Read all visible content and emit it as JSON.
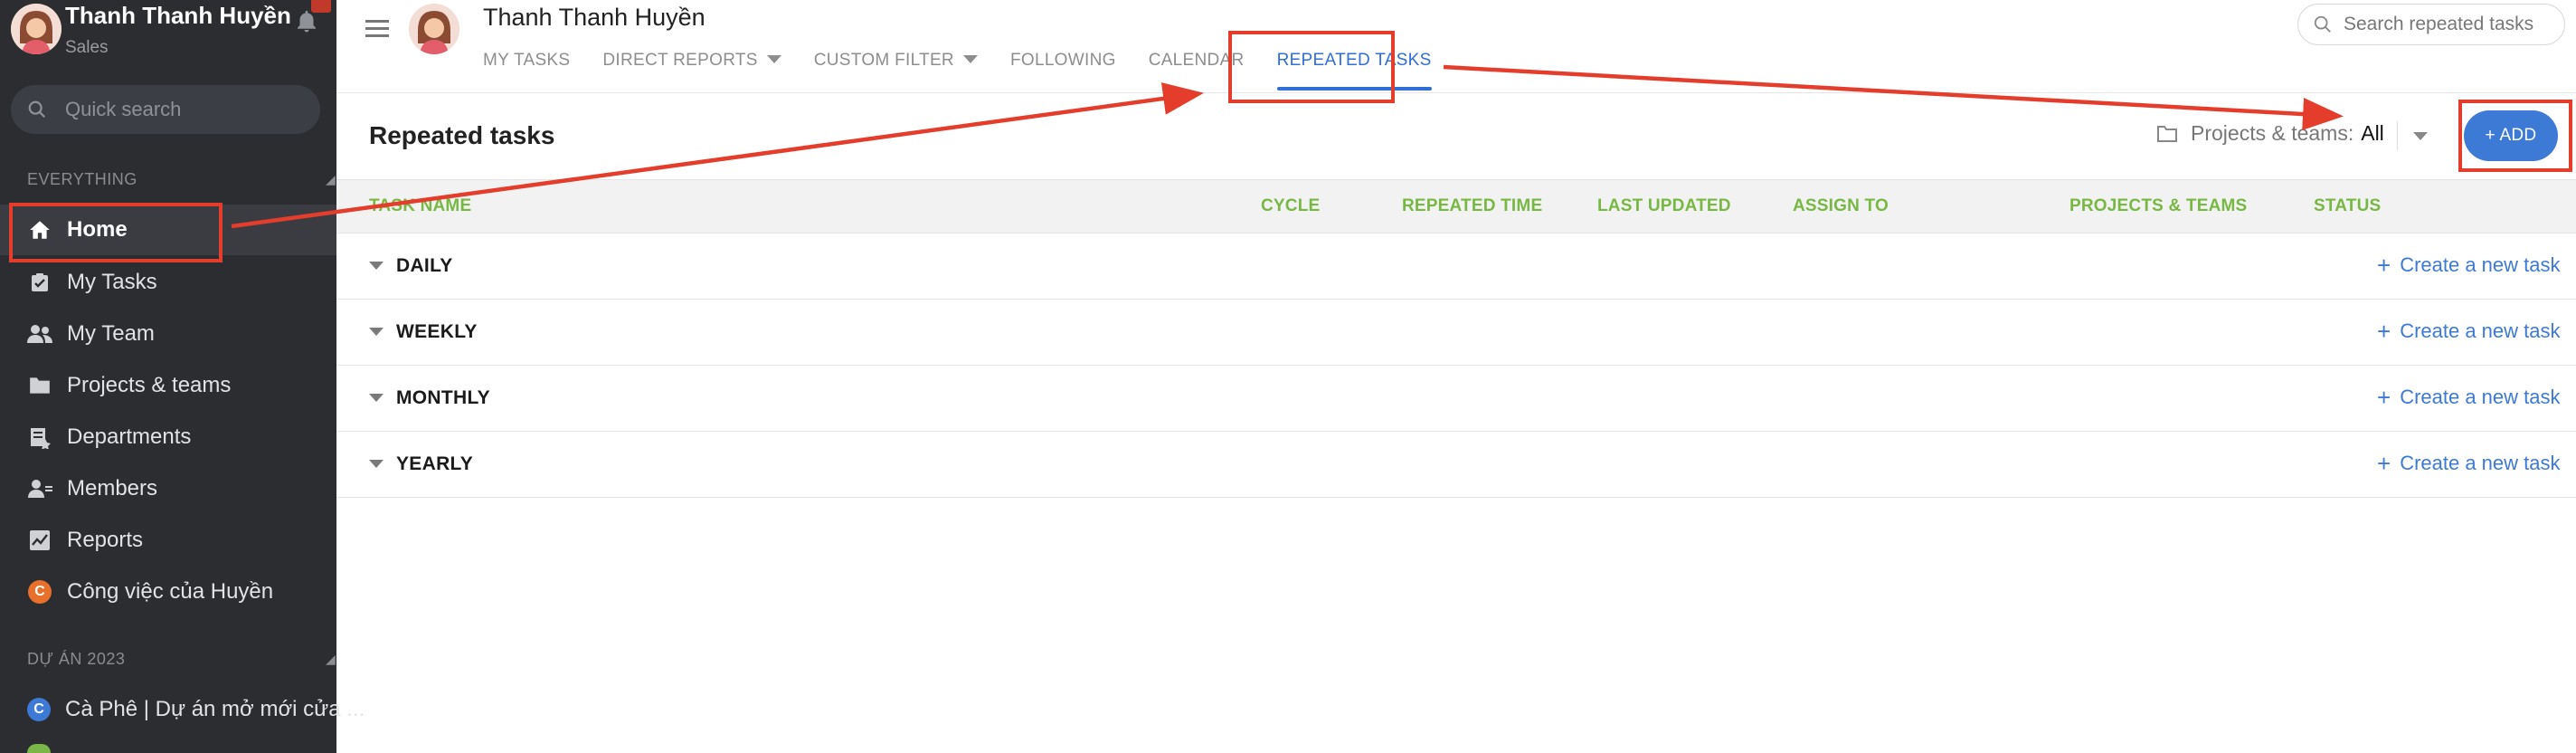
{
  "sidebar": {
    "user_name": "Thanh Thanh Huyền",
    "user_role": "Sales",
    "search_placeholder": "Quick search",
    "section_everything": "EVERYTHING",
    "items": [
      {
        "label": "Home",
        "icon": "home-icon"
      },
      {
        "label": "My Tasks",
        "icon": "task-check-icon"
      },
      {
        "label": "My Team",
        "icon": "team-icon"
      },
      {
        "label": "Projects & teams",
        "icon": "folder-icon"
      },
      {
        "label": "Departments",
        "icon": "department-icon"
      },
      {
        "label": "Members",
        "icon": "members-icon"
      },
      {
        "label": "Reports",
        "icon": "chart-icon"
      },
      {
        "label": "Công việc của Huyền",
        "badge": "C",
        "badge_color": "#e8702a"
      }
    ],
    "section_project": "DỰ ÁN 2023",
    "project_items": [
      {
        "label": "Cà Phê | Dự án mở mới cửa ...",
        "badge": "C",
        "badge_color": "#3d7ad6"
      }
    ]
  },
  "header": {
    "user_name": "Thanh Thanh Huyền",
    "tabs": [
      {
        "label": "MY TASKS"
      },
      {
        "label": "DIRECT REPORTS"
      },
      {
        "label": "CUSTOM FILTER"
      },
      {
        "label": "FOLLOWING"
      },
      {
        "label": "CALENDAR"
      },
      {
        "label": "REPEATED TASKS"
      }
    ],
    "search_placeholder": "Search repeated tasks"
  },
  "page": {
    "title": "Repeated tasks",
    "filter_label": "Projects & teams:",
    "filter_value": "All",
    "add_label": "+ ADD"
  },
  "table": {
    "columns": [
      "TASK NAME",
      "CYCLE",
      "REPEATED TIME",
      "LAST UPDATED",
      "ASSIGN TO",
      "PROJECTS & TEAMS",
      "STATUS"
    ],
    "groups": [
      {
        "name": "DAILY",
        "action": "Create a new task"
      },
      {
        "name": "WEEKLY",
        "action": "Create a new task"
      },
      {
        "name": "MONTHLY",
        "action": "Create a new task"
      },
      {
        "name": "YEARLY",
        "action": "Create a new task"
      }
    ]
  },
  "colors": {
    "sidebar_bg": "#2b2d31",
    "accent_blue": "#3d7ad6",
    "column_header_green": "#77b843",
    "annotation_red": "#e43d2b"
  }
}
